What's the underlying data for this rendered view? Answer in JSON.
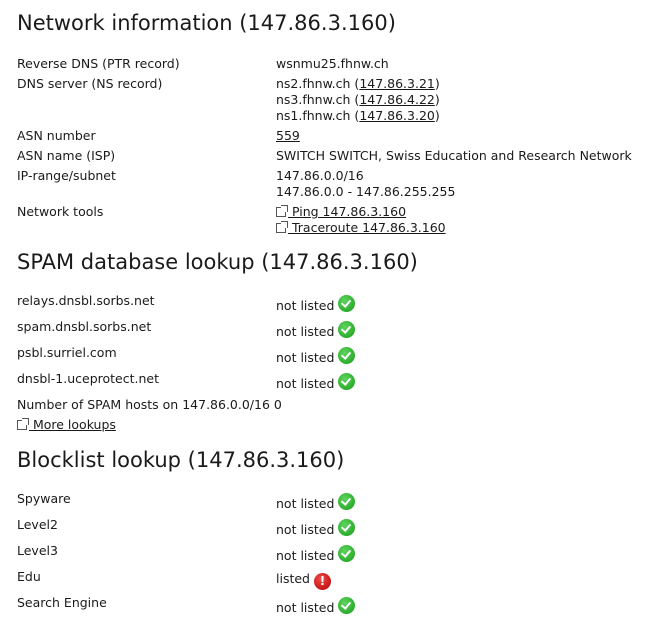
{
  "network": {
    "title": "Network information (147.86.3.160)",
    "reverse_dns_label": "Reverse DNS (PTR record)",
    "reverse_dns_value": "wsnmu25.fhnw.ch",
    "dns_server_label": "DNS server (NS record)",
    "dns_servers": [
      {
        "host": "ns2.fhnw.ch (",
        "ip": "147.86.3.21",
        "close": ")"
      },
      {
        "host": "ns3.fhnw.ch (",
        "ip": "147.86.4.22",
        "close": ")"
      },
      {
        "host": "ns1.fhnw.ch (",
        "ip": "147.86.3.20",
        "close": ")"
      }
    ],
    "asn_number_label": "ASN number",
    "asn_number_value": "559",
    "asn_name_label": "ASN name (ISP)",
    "asn_name_value": "SWITCH SWITCH, Swiss Education and Research Network",
    "ip_range_label": "IP-range/subnet",
    "ip_range_cidr": "147.86.0.0/16",
    "ip_range_span": "147.86.0.0 - 147.86.255.255",
    "tools_label": "Network tools",
    "ping_link": " Ping 147.86.3.160",
    "traceroute_link": " Traceroute 147.86.3.160"
  },
  "spam": {
    "title": "SPAM database lookup (147.86.3.160)",
    "rows": [
      {
        "name": "relays.dnsbl.sorbs.net",
        "status": "not listed"
      },
      {
        "name": "spam.dnsbl.sorbs.net",
        "status": "not listed"
      },
      {
        "name": "psbl.surriel.com",
        "status": "not listed"
      },
      {
        "name": "dnsbl-1.uceprotect.net",
        "status": "not listed"
      }
    ],
    "hosts_label": "Number of SPAM hosts on 147.86.0.0/16",
    "hosts_value": "0",
    "more_link": " More lookups"
  },
  "blocklist": {
    "title": "Blocklist lookup (147.86.3.160)",
    "rows": [
      {
        "name": "Spyware",
        "status": "not listed"
      },
      {
        "name": "Level2",
        "status": "not listed"
      },
      {
        "name": "Level3",
        "status": "not listed"
      },
      {
        "name": "Edu",
        "status": "listed",
        "icon_text": "!"
      },
      {
        "name": "Search Engine",
        "status": "not listed"
      }
    ]
  },
  "colors": {
    "ok": "#1faa1f",
    "bad": "#d40000"
  },
  "icons": {
    "ok": "checkmark-icon",
    "bad": "exclamation-icon",
    "external": "external-link-icon"
  }
}
